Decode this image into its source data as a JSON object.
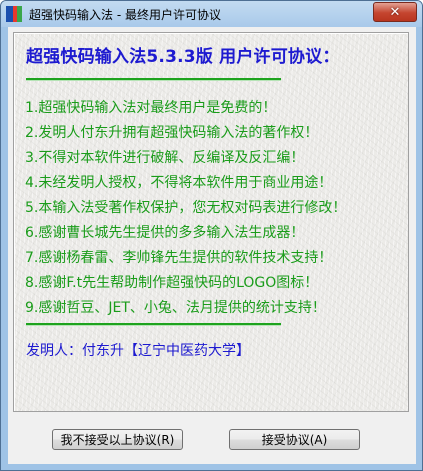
{
  "window": {
    "title": "超强快码输入法 - 最终用户许可协议"
  },
  "license": {
    "heading": "超强快码输入法5.3.3版  用户许可协议：",
    "terms": [
      "1.超强快码输入法对最终用户是免费的！",
      "2.发明人付东升拥有超强快码输入法的著作权！",
      "3.不得对本软件进行破解、反编译及反汇编！",
      "4.未经发明人授权，不得将本软件用于商业用途！",
      "5.本输入法受著作权保护，您无权对码表进行修改！",
      "6.感谢曹长城先生提供的多多输入法生成器！",
      "7.感谢杨春雷、李帅锋先生提供的软件技术支持！",
      "8.感谢F.t先生帮助制作超强快码的LOGO图标！",
      "9.感谢哲豆、JET、小兔、法月提供的统计支持！"
    ],
    "inventor": "发明人：付东升【辽宁中医药大学】"
  },
  "buttons": {
    "decline_label": "我不接受以上协议(R)",
    "accept_label": "接受协议(A)"
  },
  "colors": {
    "heading": "#1d1ad0",
    "terms": "#1a9c1a",
    "inventor": "#1d1ad0",
    "divider": "#1ea31e",
    "title_bar": "#a9c9ea",
    "close_button": "#c5452f"
  },
  "icons": {
    "app": "app-icon",
    "close": "close-icon"
  }
}
